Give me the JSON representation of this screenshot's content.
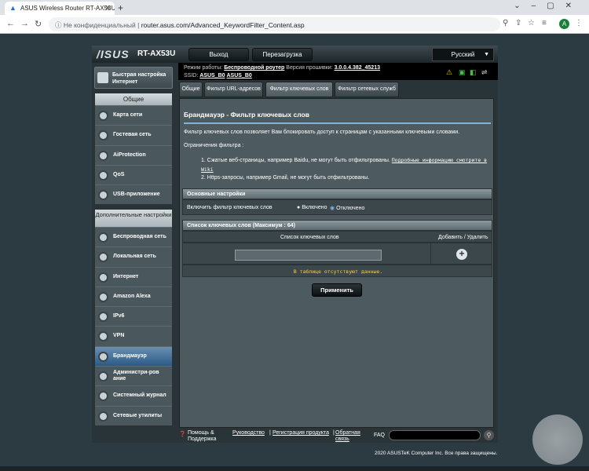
{
  "browser": {
    "tab_title": "ASUS Wireless Router RT-AX53U",
    "tab_icon": "router-favicon",
    "new_tab": "+",
    "address_warning": "Не конфиденциальный",
    "address_url": "router.asus.com/Advanced_KeywordFilter_Content.asp",
    "avatar_letter": "A"
  },
  "header": {
    "logo": "/ISUS",
    "model": "RT-AX53U",
    "logout_label": "Выход",
    "reboot_label": "Перезагрузка",
    "language": "Русский",
    "mode_label": "Режим работы:",
    "mode_value": "Беспроводной роутер",
    "firmware_label": "Версия прошивки:",
    "firmware_value": "3.0.0.4.382_45213",
    "ssid_label": "SSID:",
    "ssid_1": "ASUS_B0",
    "ssid_2": "ASUS_B0"
  },
  "sidebar": {
    "quick_setup": "Быстрая настройка Интернет",
    "general_header": "Общие",
    "general_items": [
      {
        "label": "Карта сети",
        "icon": "network-map-icon"
      },
      {
        "label": "Гостевая сеть",
        "icon": "guest-network-icon"
      },
      {
        "label": "AiProtection",
        "icon": "shield-icon"
      },
      {
        "label": "QoS",
        "icon": "qos-icon"
      },
      {
        "label": "USB-приложение",
        "icon": "usb-icon"
      }
    ],
    "advanced_header": "Дополнительные настройки",
    "advanced_items": [
      {
        "label": "Беспроводная сеть",
        "icon": "wireless-icon"
      },
      {
        "label": "Локальная сеть",
        "icon": "lan-icon"
      },
      {
        "label": "Интернет",
        "icon": "globe-icon"
      },
      {
        "label": "Amazon Alexa",
        "icon": "alexa-icon"
      },
      {
        "label": "IPv6",
        "icon": "ipv6-icon"
      },
      {
        "label": "VPN",
        "icon": "vpn-icon"
      },
      {
        "label": "Брандмауэр",
        "icon": "firewall-icon"
      },
      {
        "label": "Администри-рование",
        "icon": "admin-icon"
      },
      {
        "label": "Системный журнал",
        "icon": "log-icon"
      },
      {
        "label": "Сетевые утилиты",
        "icon": "tools-icon"
      }
    ]
  },
  "tabs": [
    "Общие",
    "Фильтр URL-адресов",
    "Фильтр ключевых слов",
    "Фильтр сетевых служб"
  ],
  "content": {
    "title": "Брандмауэр - Фильтр ключевых слов",
    "description": "Фильтр ключевых слов позволяет Вам блокировать доступ к страницам с указанными ключевыми словами.",
    "limits_label": "Ограничения фильтра :",
    "limit_1": "1. Сжатые веб-страницы, например Baidu, не могут быть отфильтрованы.",
    "limit_1_link": "Подробные информацию смотрите в",
    "limit_1_link2": "Wiki",
    "limit_2": "2. Https-запросы, например Gmail, не могут быть отфильтрованы.",
    "basic_header": "Основные настройки",
    "enable_label": "Включить фильтр ключевых слов",
    "radio_on": "Включено",
    "radio_off": "Отключено",
    "list_header": "Список ключевых слов (Максимум : 64)",
    "col_keywords": "Список ключевых слов",
    "col_add_remove": "Добавить / Удалить",
    "add_symbol": "+",
    "keyword_input_value": "",
    "empty_message": "В таблице отсутствуют данные.",
    "apply_label": "Применить"
  },
  "footer": {
    "help": "Помощь & Поддержка",
    "manual": "Руководство",
    "sep1": "|",
    "registration": "Регистрация продукта",
    "sep2": "|",
    "feedback": "Обратная связь",
    "faq": "FAQ",
    "copyright": "2020 ASUSTeK Computer Inc. Все права защищены."
  },
  "colors": {
    "active_tab": "#4f5b60",
    "accent_line": "#7fb5dc",
    "empty_text": "#ffcc33"
  }
}
